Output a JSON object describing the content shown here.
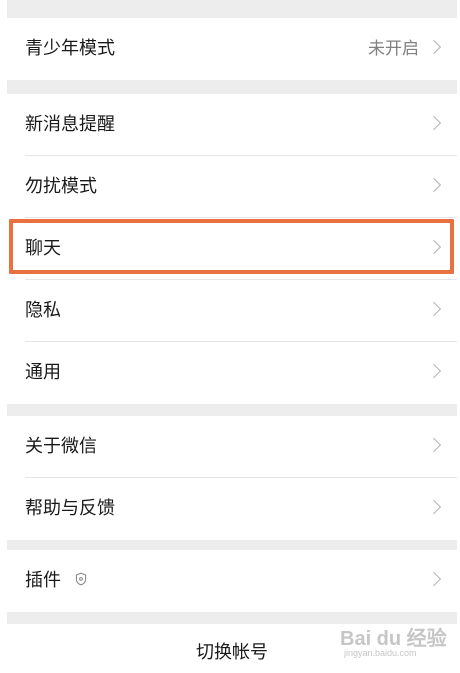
{
  "rows": [
    {
      "label": "青少年模式",
      "value": "未开启"
    },
    {
      "label": "新消息提醒"
    },
    {
      "label": "勿扰模式"
    },
    {
      "label": "聊天"
    },
    {
      "label": "隐私"
    },
    {
      "label": "通用"
    },
    {
      "label": "关于微信"
    },
    {
      "label": "帮助与反馈"
    },
    {
      "label": "插件"
    }
  ],
  "switch_account": "切换帐号",
  "watermark": {
    "text": "Bai du 经验",
    "sub": "jingyan.baidu.com"
  },
  "colors": {
    "highlight": "#e8713f",
    "background": "#ededed",
    "chevron": "#b3b3b3"
  }
}
